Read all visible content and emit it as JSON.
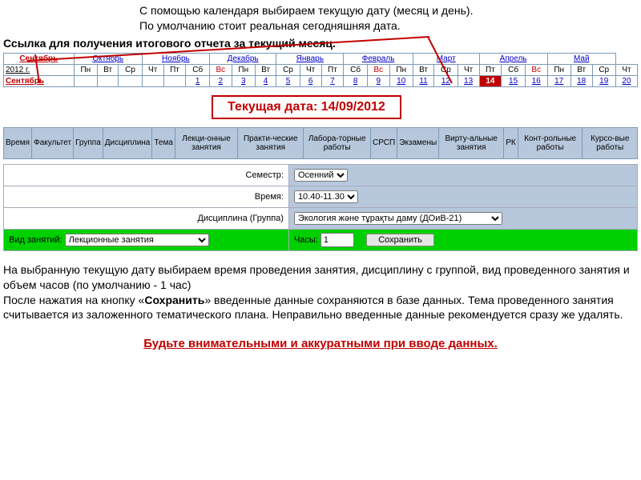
{
  "instr": {
    "top1": "С помощью календаря выбираем текущую дату (месяц и день).",
    "top2": "По умолчанию стоит реальная сегодняшняя дата.",
    "bold": "Ссылка для получения итогового отчета за текущий месяц."
  },
  "months": [
    "Сентябрь",
    "Октябрь",
    "Ноябрь",
    "Декабрь",
    "Январь",
    "Февраль",
    "Март",
    "Апрель",
    "Май"
  ],
  "year_label": "2012 г.",
  "current_month": "Сентябрь",
  "weekdays": [
    "Пн",
    "Вт",
    "Ср",
    "Чт",
    "Пт",
    "Сб",
    "Вс"
  ],
  "days": [
    "1",
    "2",
    "3",
    "4",
    "5",
    "6",
    "7",
    "8",
    "9",
    "10",
    "11",
    "12",
    "13",
    "14",
    "15",
    "16",
    "17",
    "18",
    "19",
    "20"
  ],
  "today_index": 13,
  "current_date_label": "Текущая дата: 14/09/2012",
  "columns": [
    "Время",
    "Факультет",
    "Группа",
    "Дисциплина",
    "Тема",
    "Лекци-онные занятия",
    "Практи-ческие занятия",
    "Лабора-торные работы",
    "СРСП",
    "Экзамены",
    "Вирту-альные занятия",
    "РК",
    "Конт-рольные работы",
    "Курсо-вые работы"
  ],
  "form": {
    "semester_label": "Семестр:",
    "semester_value": "Осенний",
    "time_label": "Время:",
    "time_value": "10.40-11.30",
    "discipline_label": "Дисциплина (Группа)",
    "discipline_value": "Экология және тұрақты даму (ДОиВ-21)",
    "type_label": "Вид занятий:",
    "type_value": "Лекционные занятия",
    "hours_label": "Часы:",
    "hours_value": "1",
    "save_label": "Сохранить"
  },
  "para1": "На выбранную текущую дату выбираем время проведения занятия, дисциплину с группой, вид проведенного занятия и объем часов (по умолчанию - 1 час)",
  "para2_a": "После нажатия на кнопку «",
  "para2_b": "Сохранить",
  "para2_c": "» введенные данные сохраняются в базе данных. Тема проведенного занятия считывается из заложенного тематического плана. Неправильно введенные данные рекомендуется сразу же удалять.",
  "warn": "Будьте внимательными и аккуратными при вводе данных."
}
